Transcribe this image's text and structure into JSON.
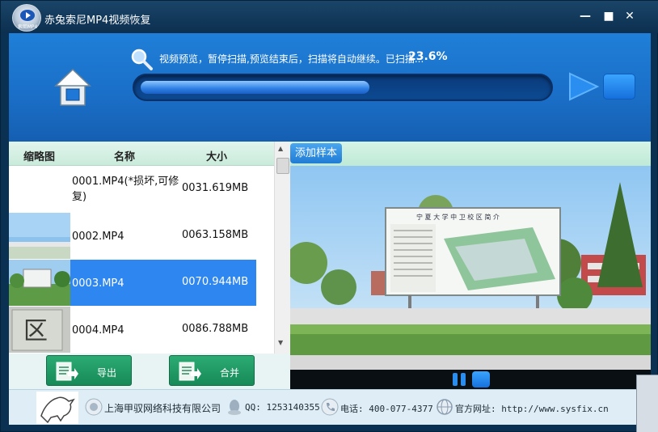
{
  "app": {
    "title": "赤兔索尼MP4视频恢复",
    "logo_text": "索尼MP4"
  },
  "window_controls": {
    "minimize": "—",
    "maximize": "■",
    "close": "✕"
  },
  "status": {
    "message": "视频预览，暂停扫描,预览结束后，扫描将自动继续。已扫描...",
    "percent_text": "23.6%",
    "progress": 0.236
  },
  "list": {
    "headers": {
      "thumbnail": "缩略图",
      "name": "名称",
      "size": "大小"
    },
    "rows": [
      {
        "name": "0001.MP4(*损坏,可修复)",
        "size": "0031.619MB",
        "selected": false,
        "thumb": "blank"
      },
      {
        "name": "0002.MP4",
        "size": "0063.158MB",
        "selected": false,
        "thumb": "sky"
      },
      {
        "name": "0003.MP4",
        "size": "0070.944MB",
        "selected": true,
        "thumb": "billboard"
      },
      {
        "name": "0004.MP4",
        "size": "0086.788MB",
        "selected": false,
        "thumb": "stone"
      }
    ]
  },
  "actions": {
    "export_label": "导出",
    "merge_label": "合并"
  },
  "preview": {
    "add_sample_label": "添加样本",
    "billboard_title": "宁 夏 大 学 中 卫 校 区 简 介"
  },
  "footer": {
    "company": "上海甲驭网络科技有限公司",
    "qq": "QQ: 1253140355",
    "phone": "电话: 400-077-4377",
    "website": "官方网址: http://www.sysfix.cn"
  },
  "icons": {
    "home": "home-icon",
    "search": "search-icon",
    "play": "play-icon",
    "stop": "stop-icon",
    "pause": "pause-icon",
    "export": "export-icon",
    "merge": "merge-icon",
    "qq": "qq-icon",
    "phone": "phone-icon",
    "web": "globe-icon"
  },
  "colors": {
    "accent_blue": "#1f7fd8",
    "selection": "#2e86f0",
    "button_green": "#2cab73"
  }
}
